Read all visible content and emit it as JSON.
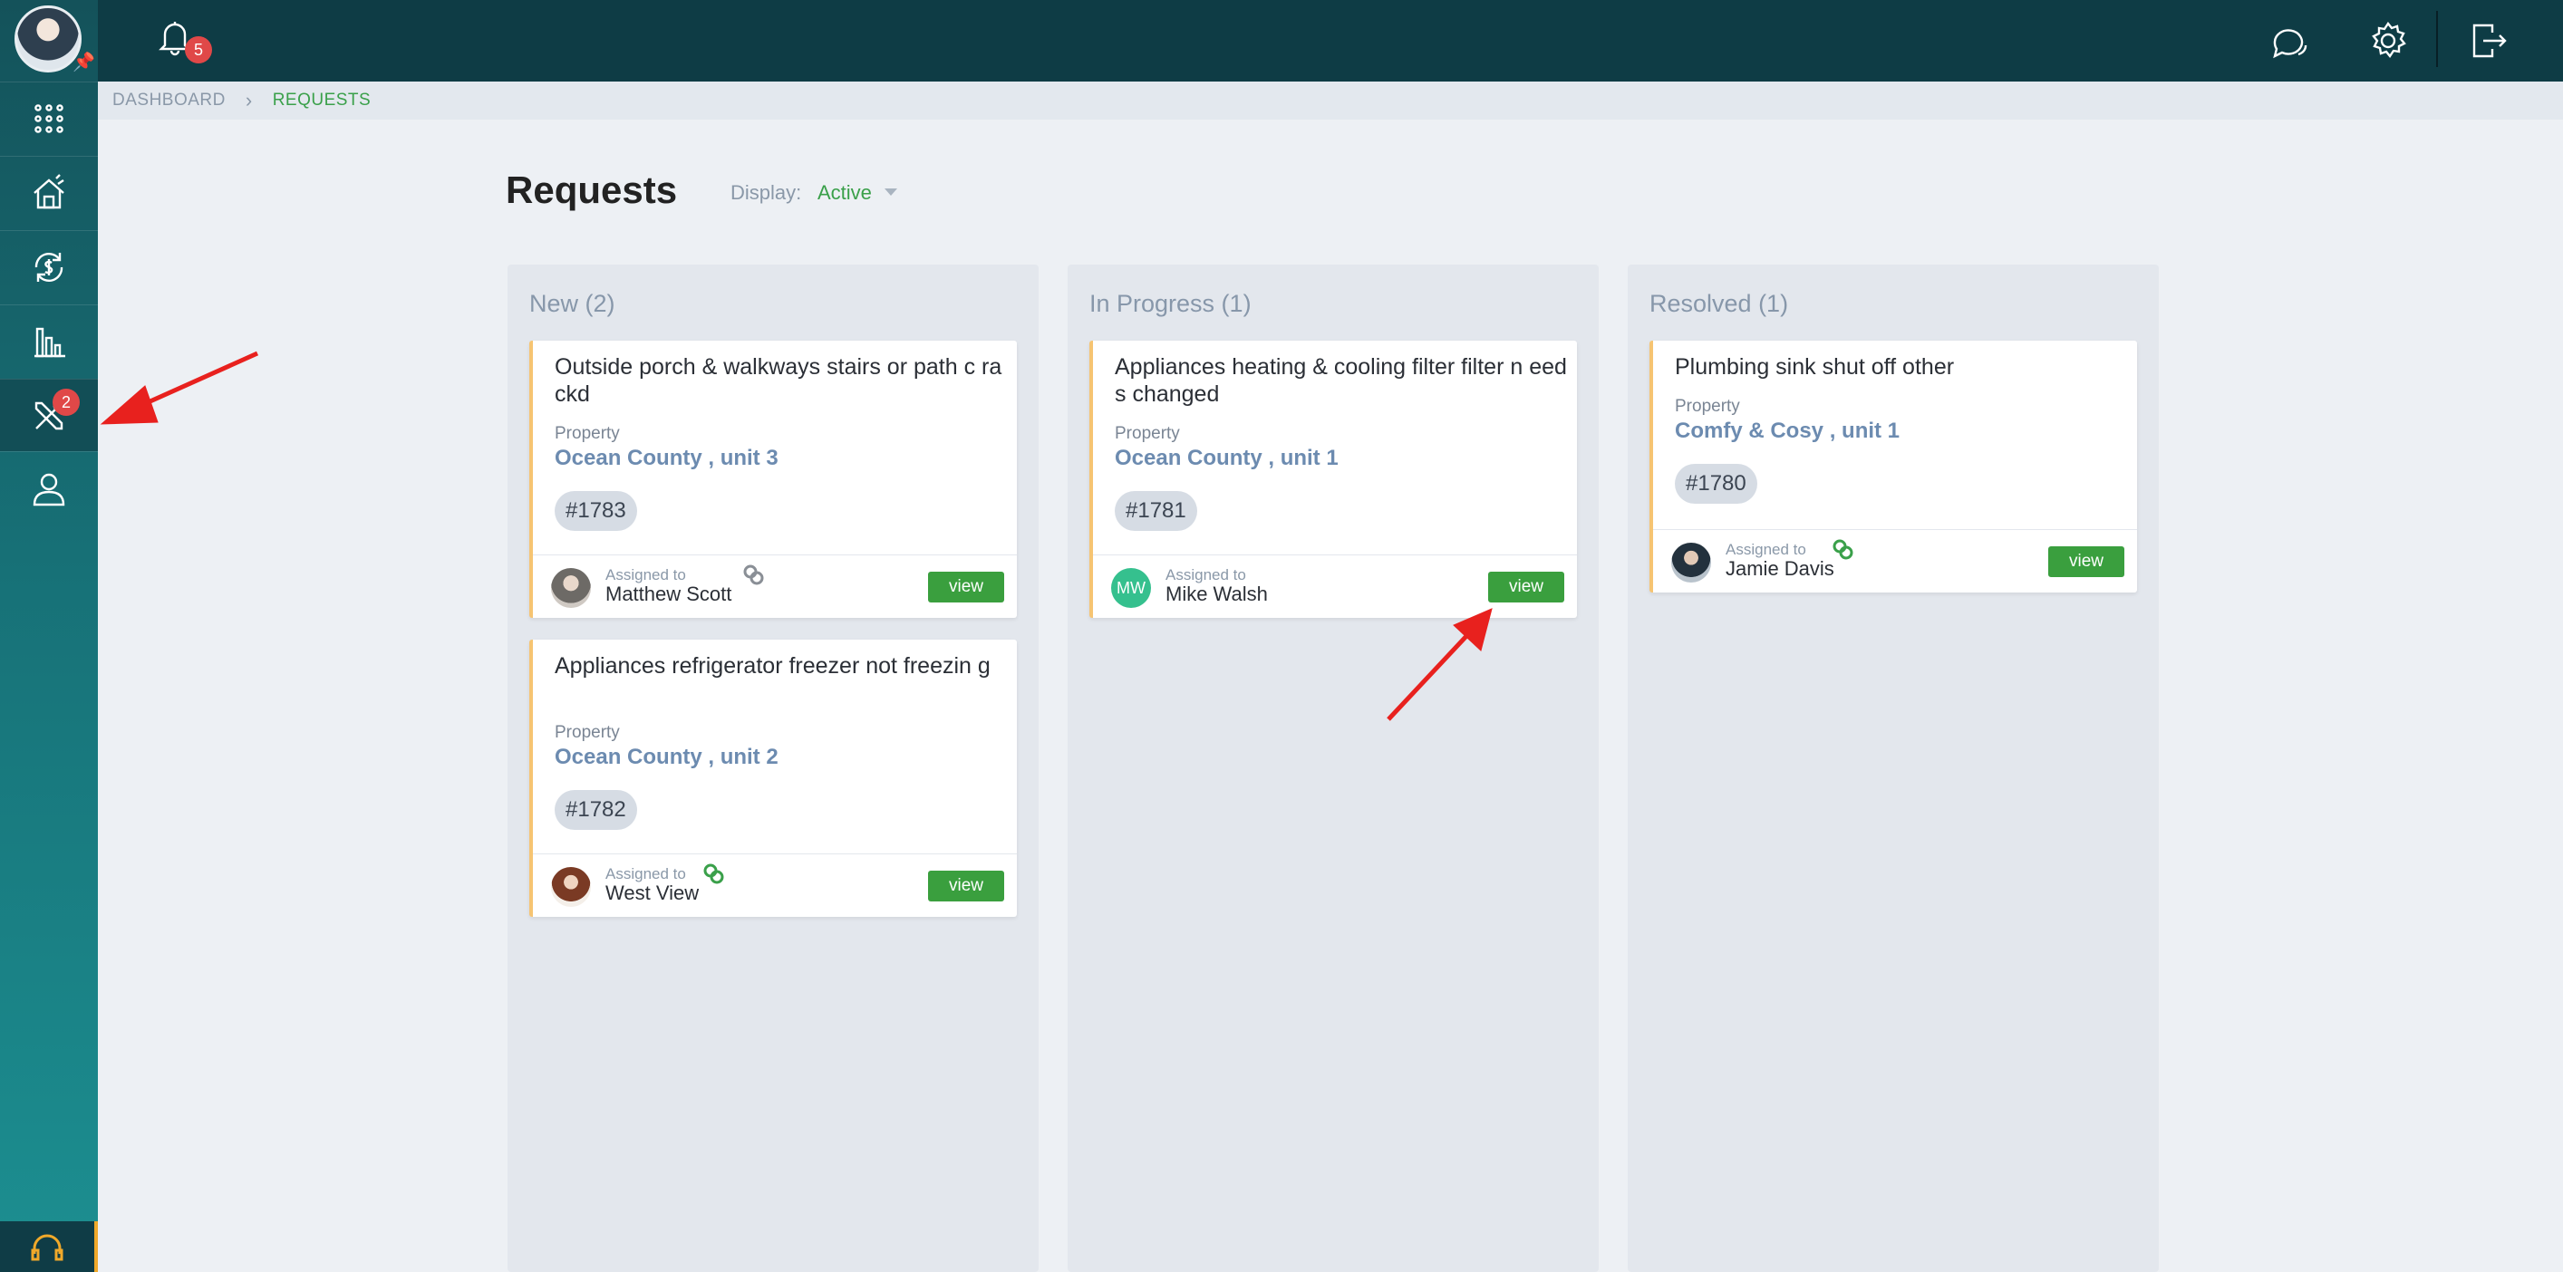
{
  "sidebar": {
    "items": [
      {
        "name": "apps-grid-icon"
      },
      {
        "name": "property-house-icon"
      },
      {
        "name": "payments-cycle-icon"
      },
      {
        "name": "reports-chart-icon"
      },
      {
        "name": "maintenance-tools-icon",
        "badge": "2",
        "active": true
      },
      {
        "name": "user-profile-icon"
      }
    ]
  },
  "topbar": {
    "notifications_count": "5"
  },
  "breadcrumb": {
    "root": "DASHBOARD",
    "current": "REQUESTS"
  },
  "page": {
    "title": "Requests",
    "display_label": "Display:",
    "display_value": "Active"
  },
  "columns": [
    {
      "title": "New (2)",
      "cards": [
        {
          "title": "Outside porch & walkways stairs or path c rackd",
          "property_label": "Property",
          "property": "Ocean County , unit 3",
          "tag": "#1783",
          "assigned_label": "Assigned to",
          "assignee": "Matthew Scott",
          "view": "view"
        },
        {
          "title": "Appliances refrigerator freezer not freezin g",
          "property_label": "Property",
          "property": "Ocean County , unit 2",
          "tag": "#1782",
          "assigned_label": "Assigned to",
          "assignee": "West View",
          "view": "view"
        }
      ]
    },
    {
      "title": "In Progress (1)",
      "cards": [
        {
          "title": "Appliances heating & cooling filter filter n eeds changed",
          "property_label": "Property",
          "property": "Ocean County , unit 1",
          "tag": "#1781",
          "assigned_label": "Assigned to",
          "assignee": "Mike Walsh",
          "initials": "MW",
          "view": "view"
        }
      ]
    },
    {
      "title": "Resolved (1)",
      "cards": [
        {
          "title": "Plumbing sink shut off other",
          "property_label": "Property",
          "property": "Comfy & Cosy , unit 1",
          "tag": "#1780",
          "assigned_label": "Assigned to",
          "assignee": "Jamie Davis",
          "view": "view"
        }
      ]
    }
  ],
  "colors": {
    "accent_green": "#3a9f3e",
    "topbar": "#0e3c45",
    "badge_red": "#e04848",
    "card_border": "#f6c472",
    "annotation_red": "#e8211e"
  }
}
